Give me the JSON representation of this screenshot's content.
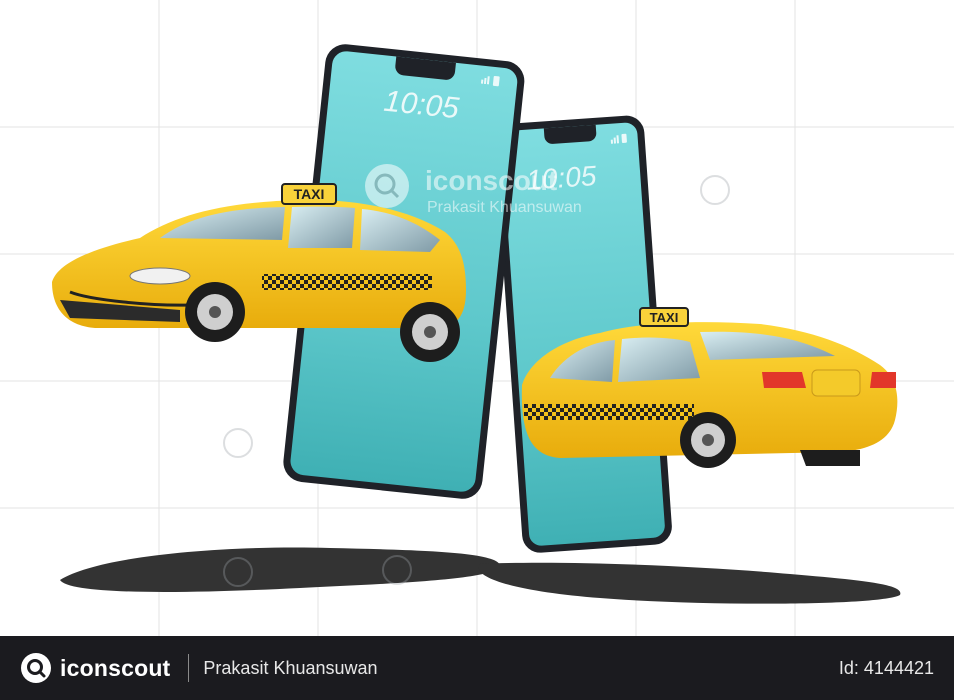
{
  "phones": {
    "front_time": "10:05",
    "back_time": "10:05"
  },
  "cars": {
    "front_sign": "TAXI",
    "back_sign": "TAXI"
  },
  "watermark": {
    "brand": "iconscout",
    "author": "Prakasit Khuansuwan"
  },
  "footer": {
    "brand": "iconscout",
    "author": "Prakasit Khuansuwan",
    "asset_id": "Id: 4144421"
  },
  "colors": {
    "taxi_yellow": "#f7c81e",
    "screen_teal": "#6ed3d6",
    "phone_frame": "#1f2228",
    "footer_bg": "#1b1b1f"
  }
}
